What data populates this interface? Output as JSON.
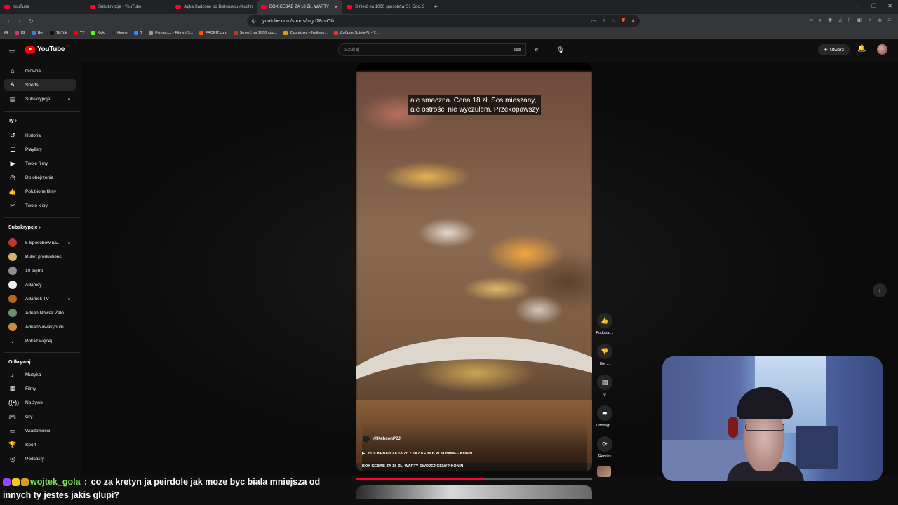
{
  "browser": {
    "tabs": [
      {
        "title": "YouTube",
        "active": false
      },
      {
        "title": "Subskrypcje - YouTube",
        "active": false
      },
      {
        "title": "Jajka Sadzone po Białorusku #kuchn",
        "active": false
      },
      {
        "title": "BOX KEBAB ZA 18 ZŁ, WARTY",
        "active": true
      },
      {
        "title": "Śmierć na 1000 sposobów S1 Odc. 3",
        "active": false
      }
    ],
    "url": "youtube.com/shorts/mgrI28zcOtk",
    "bookmarks": [
      "IG",
      "Bet",
      "TikTok",
      "YT",
      "Kick",
      "Home",
      "T",
      "Filman.cc - Filmy i S...",
      "FACEIT.com",
      "Śmierć na 1000 spo...",
      "Zagraj.my – Najleps...",
      "Доброе SztolePL - Y..."
    ]
  },
  "header": {
    "logo_text": "YouTube",
    "logo_region": "PL",
    "search_placeholder": "Szukaj",
    "create_label": "Utwórz"
  },
  "sidebar": {
    "main": [
      {
        "label": "Główna",
        "icon": "home-icon"
      },
      {
        "label": "Shorts",
        "icon": "shorts-icon"
      },
      {
        "label": "Subskrypcje",
        "icon": "subscriptions-icon"
      }
    ],
    "you_heading": "Ty",
    "you": [
      {
        "label": "Historia",
        "icon": "history-icon"
      },
      {
        "label": "Playlisty",
        "icon": "playlist-icon"
      },
      {
        "label": "Twoje filmy",
        "icon": "video-icon"
      },
      {
        "label": "Do obejrzenia",
        "icon": "clock-icon"
      },
      {
        "label": "Polubione filmy",
        "icon": "like-icon"
      },
      {
        "label": "Twoje klipy",
        "icon": "scissors-icon"
      }
    ],
    "subs_heading": "Subskrypcje",
    "subs": [
      {
        "label": "5 Sposobów na...",
        "color": "#c0392b",
        "new": true
      },
      {
        "label": "Bullet productions",
        "color": "#d4b06a",
        "new": false
      },
      {
        "label": "10 piętro",
        "color": "#8e8e8e",
        "new": false
      },
      {
        "label": "Adamcy",
        "color": "#f0f0f0",
        "new": false
      },
      {
        "label": "Adamek TV",
        "color": "#b5651d",
        "new": true
      },
      {
        "label": "Adrian Nowak Żało",
        "color": "#6b8e6b",
        "new": false
      },
      {
        "label": "AdrianNowakyoutu...",
        "color": "#c98a3a",
        "new": false
      }
    ],
    "show_more": "Pokaż więcej",
    "explore_heading": "Odkrywaj",
    "explore": [
      {
        "label": "Muzyka",
        "icon": "music-icon"
      },
      {
        "label": "Filmy",
        "icon": "film-icon"
      },
      {
        "label": "Na żywo",
        "icon": "live-icon"
      },
      {
        "label": "Gry",
        "icon": "gamepad-icon"
      },
      {
        "label": "Wiadomości",
        "icon": "news-icon"
      },
      {
        "label": "Sport",
        "icon": "trophy-icon"
      },
      {
        "label": "Podcasty",
        "icon": "podcast-icon"
      }
    ]
  },
  "short": {
    "subtitle_line1": "ale smaczna. Cena 18 zł. Sos mieszany,",
    "subtitle_line2": "ale ostrości nie wyczułem. Przekopawszy",
    "channel": "@KebsonPZJ",
    "music": "BOX KEBAB ZA 18 ZŁ Z TAZ KEBAB W KONINIE - KONIN",
    "description": "BOX KEBAB ZA 18 ZŁ, WARTY SWOJEJ CENY? KONIN",
    "progress": 0.54
  },
  "actions": {
    "like": "Podoba ...",
    "dislike": "Nie ...",
    "comments": "0",
    "share": "Udostęp...",
    "remix": "Remiks"
  },
  "chat": {
    "username": "wojtek_gola",
    "separator": " : ",
    "message_line1": "co za kretyn ja peirdole jak moze byc biala mniejsza od",
    "message_line2": "innych ty jestes jakis glupi?"
  }
}
